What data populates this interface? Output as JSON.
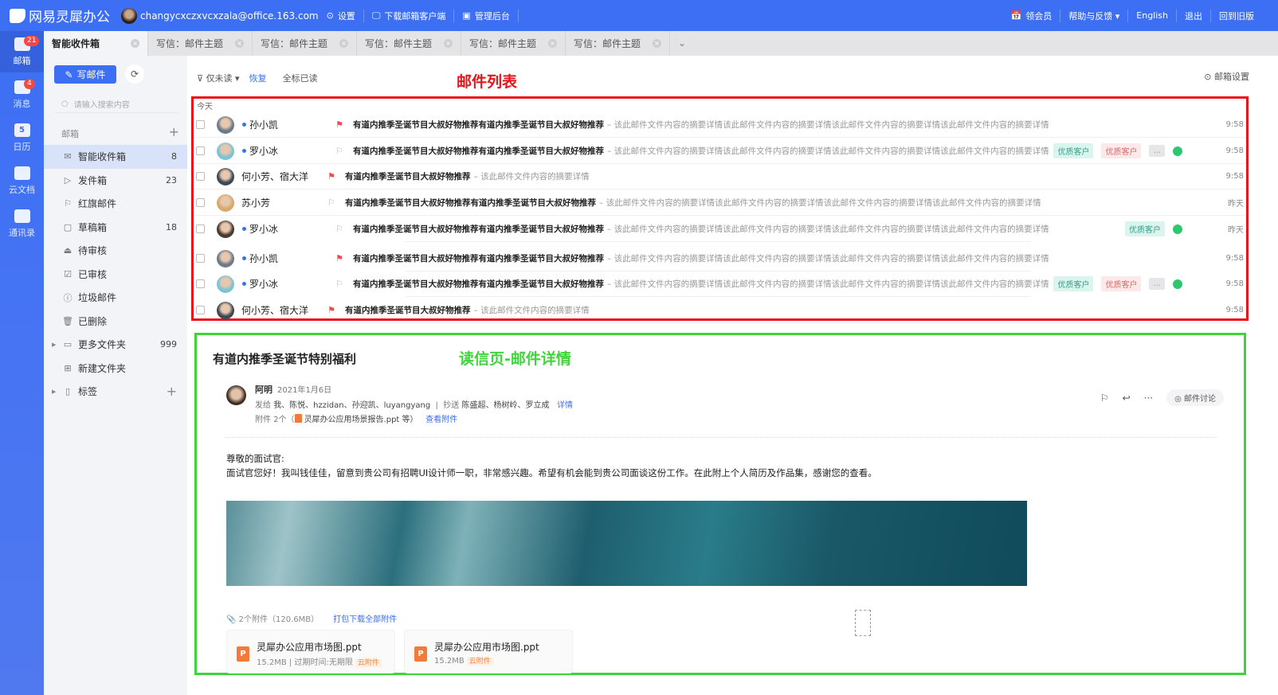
{
  "topbar": {
    "logo": "网易灵犀办公",
    "email": "changycxczxvcxzala@office.163.com",
    "links": [
      "设置",
      "下载邮箱客户端",
      "管理后台"
    ],
    "right": [
      "领会员",
      "帮助与反馈 ▾",
      "English",
      "退出",
      "回到旧版"
    ]
  },
  "rail": [
    {
      "label": "邮箱",
      "badge": "21",
      "icon": "mail-icon"
    },
    {
      "label": "消息",
      "badge": "4",
      "icon": "message-icon"
    },
    {
      "label": "日历",
      "badge": null,
      "icon": "calendar-icon",
      "glyph": "5"
    },
    {
      "label": "云文档",
      "badge": null,
      "icon": "cloud-doc-icon"
    },
    {
      "label": "通讯录",
      "badge": null,
      "icon": "contacts-icon"
    }
  ],
  "tabs": [
    "智能收件箱",
    "写信：邮件主题",
    "写信：邮件主题",
    "写信：邮件主题",
    "写信：邮件主题",
    "写信：邮件主题"
  ],
  "sidebar": {
    "write": "写邮件",
    "search_placeholder": "请输入搜索内容",
    "section": "邮箱",
    "folders": [
      {
        "label": "智能收件箱",
        "count": "8",
        "icon": "✉",
        "active": true
      },
      {
        "label": "发件箱",
        "count": "23",
        "icon": "▷"
      },
      {
        "label": "红旗邮件",
        "count": "",
        "icon": "⚐"
      },
      {
        "label": "草稿箱",
        "count": "18",
        "icon": "▢"
      },
      {
        "label": "待审核",
        "count": "",
        "icon": "⏏"
      },
      {
        "label": "已审核",
        "count": "",
        "icon": "☑"
      },
      {
        "label": "垃圾邮件",
        "count": "",
        "icon": "ⓘ"
      },
      {
        "label": "已删除",
        "count": "",
        "icon": "🗑"
      },
      {
        "label": "更多文件夹",
        "count": "999",
        "icon": "▭",
        "arrow": true
      },
      {
        "label": "新建文件夹",
        "count": "",
        "icon": "⊞"
      },
      {
        "label": "标签",
        "count": "+",
        "icon": "▯",
        "arrow": true
      }
    ]
  },
  "filter": {
    "unread": "仅未读",
    "restore": "恢复",
    "mark_all": "全标已读",
    "settings": "邮箱设置"
  },
  "annotations": {
    "list": "邮件列表",
    "detail": "读信页-邮件详情"
  },
  "list": {
    "group": "今天",
    "rows": [
      {
        "sender": "孙小凯",
        "unread": true,
        "flag": true,
        "subject": "有道内推季圣诞节目大叔好物推荐有道内推季圣诞节目大叔好物推荐",
        "preview": "– 该此邮件文件内容的摘要详情该此邮件文件内容的摘要详情该此邮件文件内容的摘要详情该此邮件文件内容的摘要详情",
        "tags": [],
        "wechat": false,
        "time": "9:58",
        "avatar": "#6d7a8c"
      },
      {
        "sender": "罗小冰",
        "unread": true,
        "flag": false,
        "subject": "有道内推季圣诞节目大叔好物推荐有道内推季圣诞节目大叔好物推荐",
        "preview": "– 该此邮件文件内容的摘要详情该此邮件文件内容的摘要详情该此邮件文件内容的摘要详情该此邮件文件内容的摘要详情",
        "tags": [
          "优质客户",
          "优质客户",
          "..."
        ],
        "wechat": true,
        "time": "9:58",
        "avatar": "#7cc3d6"
      },
      {
        "sender": "何小芳、宿大洋",
        "unread": false,
        "flag": true,
        "subject": "有道内推季圣诞节目大叔好物推荐",
        "preview": "– 该此邮件文件内容的摘要详情",
        "tags": [],
        "wechat": false,
        "time": "9:58",
        "avatar": "#3c4a56"
      },
      {
        "sender": "苏小芳",
        "unread": false,
        "flag": false,
        "subject": "有道内推季圣诞节目大叔好物推荐有道内推季圣诞节目大叔好物推荐",
        "preview": "– 该此邮件文件内容的摘要详情该此邮件文件内容的摘要详情该此邮件文件内容的摘要详情该此邮件文件内容的摘要详情",
        "tags": [],
        "wechat": false,
        "time": "昨天",
        "avatar": "#d9a86a"
      },
      {
        "sender": "罗小冰",
        "unread": true,
        "flag": false,
        "subject": "有道内推季圣诞节目大叔好物推荐有道内推季圣诞节目大叔好物推荐",
        "preview": "– 该此邮件文件内容的摘要详情该此邮件文件内容的摘要详情该此邮件文件内容的摘要详情该此邮件文件内容的摘要详情",
        "tags": [
          "优质客户"
        ],
        "wechat": true,
        "time": "昨天",
        "avatar": "#4a3a30"
      },
      {
        "sender": "孙小凯",
        "unread": true,
        "flag": true,
        "subject": "有道内推季圣诞节目大叔好物推荐有道内推季圣诞节目大叔好物推荐",
        "preview": "– 该此邮件文件内容的摘要详情该此邮件文件内容的摘要详情该此邮件文件内容的摘要详情该此邮件文件内容的摘要详情",
        "tags": [],
        "wechat": false,
        "time": "9:58",
        "avatar": "#6d7a8c"
      },
      {
        "sender": "罗小冰",
        "unread": true,
        "flag": false,
        "subject": "有道内推季圣诞节目大叔好物推荐有道内推季圣诞节目大叔好物推荐",
        "preview": "– 该此邮件文件内容的摘要详情该此邮件文件内容的摘要详情该此邮件文件内容的摘要详情该此邮件文件内容的摘要详情",
        "tags": [
          "优质客户",
          "优质客户",
          "..."
        ],
        "wechat": true,
        "time": "9:58",
        "avatar": "#7cc3d6"
      },
      {
        "sender": "何小芳、宿大洋",
        "unread": false,
        "flag": true,
        "subject": "有道内推季圣诞节目大叔好物推荐",
        "preview": "– 该此邮件文件内容的摘要详情",
        "tags": [],
        "wechat": false,
        "time": "9:58",
        "avatar": "#3c4a56"
      }
    ]
  },
  "reader": {
    "title": "有道内推季圣诞节特别福利",
    "from": "阿明",
    "date": "2021年1月6日",
    "to_label": "发给",
    "to": "我、陈悦、hzzidan、孙迎凯、luyangyang",
    "cc_label": "抄送",
    "cc": "陈盛超、杨树岭、罗立成",
    "details": "详情",
    "att_label": "附件",
    "att_count": "2个（",
    "att_file": "灵犀办公应用场景报告.ppt 等）",
    "view_att": "查看附件",
    "discuss": "邮件讨论",
    "greeting": "尊敬的面试官:",
    "body": "面试官您好！我叫钱佳佳，留意到贵公司有招聘UI设计师一职，非常感兴趣。希望有机会能到贵公司面谈这份工作。在此附上个人简历及作品集，感谢您的查看。",
    "att_summary": "2个附件（120.6MB）",
    "download_all": "打包下载全部附件",
    "attachments": [
      {
        "name": "灵犀办公应用市场图.ppt",
        "size": "15.2MB | 过期时间:无期限",
        "badge": "云附件"
      },
      {
        "name": "灵犀办公应用市场图.ppt",
        "size": "15.2MB",
        "badge": "云附件"
      }
    ]
  }
}
